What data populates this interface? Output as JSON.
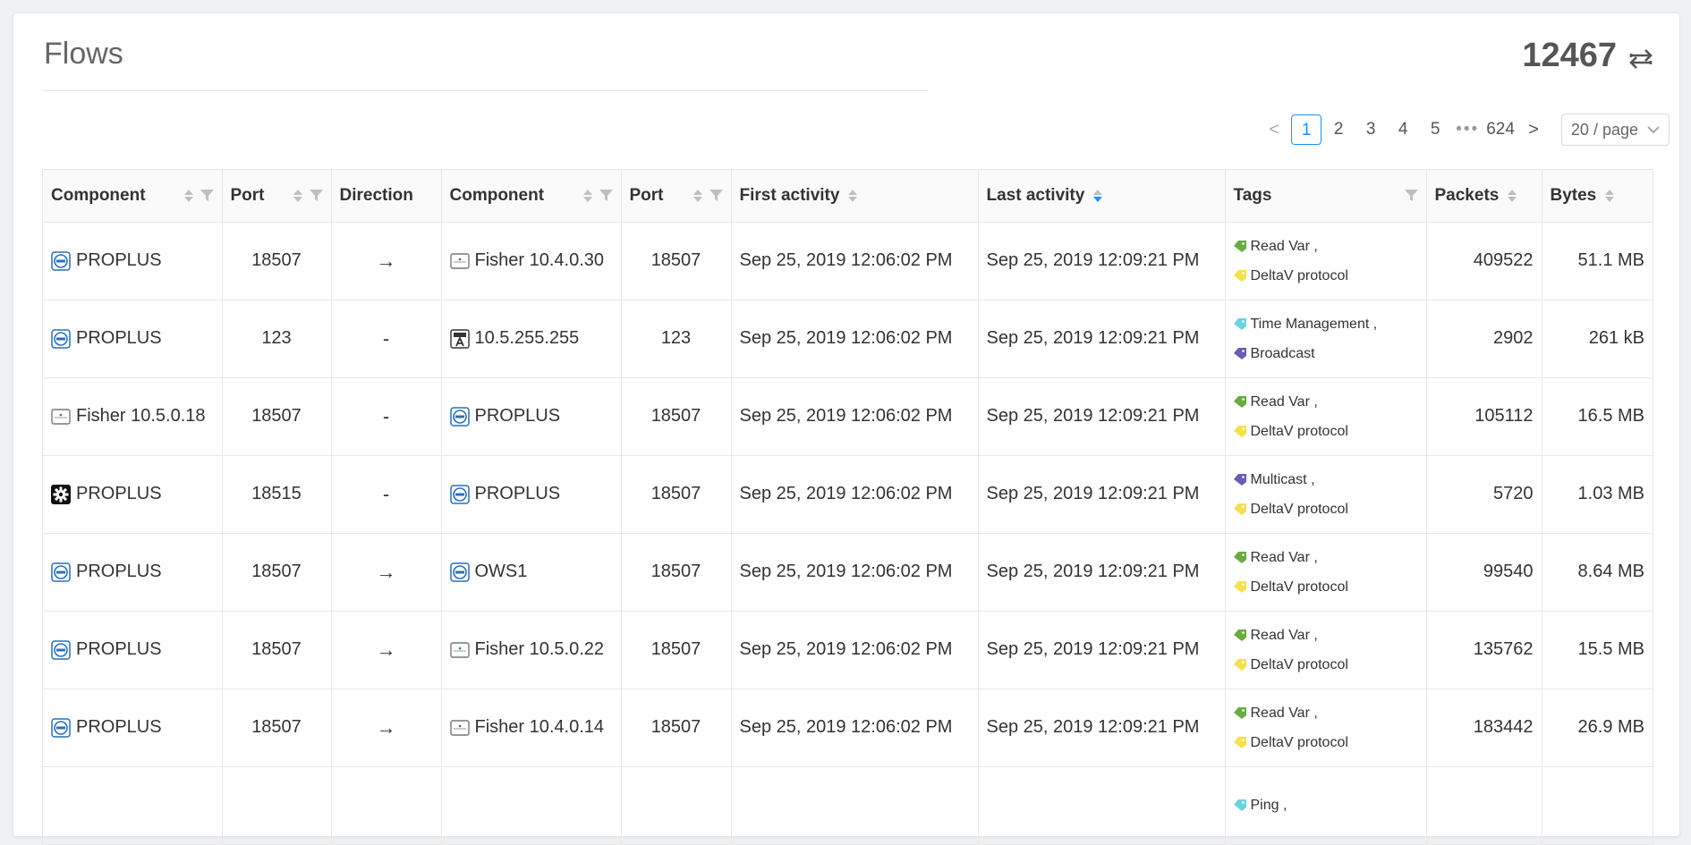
{
  "header": {
    "title": "Flows",
    "total": "12467"
  },
  "pagination": {
    "prev": "<",
    "next": ">",
    "pages": [
      "1",
      "2",
      "3",
      "4",
      "5"
    ],
    "ellipsis": "•••",
    "last": "624",
    "page_size": "20 / page"
  },
  "columns": [
    "Component",
    "Port",
    "Direction",
    "Component",
    "Port",
    "First activity",
    "Last activity",
    "Tags",
    "Packets",
    "Bytes"
  ],
  "colors": {
    "green": "#6aab43",
    "yellow": "#f5e04e",
    "cyan": "#6cd3de",
    "purple": "#6b5bb2",
    "blue": "#1890ff"
  },
  "rows": [
    {
      "src_icon": "dell-icon",
      "src": "PROPLUS",
      "sport": "18507",
      "dir": "→",
      "dst_icon": "device-icon",
      "dst": "Fisher 10.4.0.30",
      "dport": "18507",
      "first": "Sep 25, 2019 12:06:02 PM",
      "last": "Sep 25, 2019 12:09:21 PM",
      "tags": [
        {
          "label": "Read Var ,",
          "color": "green"
        },
        {
          "label": "DeltaV protocol",
          "color": "yellow"
        }
      ],
      "packets": "409522",
      "bytes": "51.1 MB"
    },
    {
      "src_icon": "dell-icon",
      "src": "PROPLUS",
      "sport": "123",
      "dir": "-",
      "dst_icon": "broadcast-icon",
      "dst": "10.5.255.255",
      "dport": "123",
      "first": "Sep 25, 2019 12:06:02 PM",
      "last": "Sep 25, 2019 12:09:21 PM",
      "tags": [
        {
          "label": "Time Management ,",
          "color": "cyan"
        },
        {
          "label": "Broadcast",
          "color": "purple"
        }
      ],
      "packets": "2902",
      "bytes": "261 kB"
    },
    {
      "src_icon": "device-icon",
      "src": "Fisher 10.5.0.18",
      "sport": "18507",
      "dir": "-",
      "dst_icon": "dell-icon",
      "dst": "PROPLUS",
      "dport": "18507",
      "first": "Sep 25, 2019 12:06:02 PM",
      "last": "Sep 25, 2019 12:09:21 PM",
      "tags": [
        {
          "label": "Read Var ,",
          "color": "green"
        },
        {
          "label": "DeltaV protocol",
          "color": "yellow"
        }
      ],
      "packets": "105112",
      "bytes": "16.5 MB"
    },
    {
      "src_icon": "gear-icon",
      "src": "PROPLUS",
      "sport": "18515",
      "dir": "-",
      "dst_icon": "dell-icon",
      "dst": "PROPLUS",
      "dport": "18507",
      "first": "Sep 25, 2019 12:06:02 PM",
      "last": "Sep 25, 2019 12:09:21 PM",
      "tags": [
        {
          "label": "Multicast ,",
          "color": "purple"
        },
        {
          "label": "DeltaV protocol",
          "color": "yellow"
        }
      ],
      "packets": "5720",
      "bytes": "1.03 MB"
    },
    {
      "src_icon": "dell-icon",
      "src": "PROPLUS",
      "sport": "18507",
      "dir": "→",
      "dst_icon": "dell-icon",
      "dst": "OWS1",
      "dport": "18507",
      "first": "Sep 25, 2019 12:06:02 PM",
      "last": "Sep 25, 2019 12:09:21 PM",
      "tags": [
        {
          "label": "Read Var ,",
          "color": "green"
        },
        {
          "label": "DeltaV protocol",
          "color": "yellow"
        }
      ],
      "packets": "99540",
      "bytes": "8.64 MB"
    },
    {
      "src_icon": "dell-icon",
      "src": "PROPLUS",
      "sport": "18507",
      "dir": "→",
      "dst_icon": "device-icon",
      "dst": "Fisher 10.5.0.22",
      "dport": "18507",
      "first": "Sep 25, 2019 12:06:02 PM",
      "last": "Sep 25, 2019 12:09:21 PM",
      "tags": [
        {
          "label": "Read Var ,",
          "color": "green"
        },
        {
          "label": "DeltaV protocol",
          "color": "yellow"
        }
      ],
      "packets": "135762",
      "bytes": "15.5 MB"
    },
    {
      "src_icon": "dell-icon",
      "src": "PROPLUS",
      "sport": "18507",
      "dir": "→",
      "dst_icon": "device-icon",
      "dst": "Fisher 10.4.0.14",
      "dport": "18507",
      "first": "Sep 25, 2019 12:06:02 PM",
      "last": "Sep 25, 2019 12:09:21 PM",
      "tags": [
        {
          "label": "Read Var ,",
          "color": "green"
        },
        {
          "label": "DeltaV protocol",
          "color": "yellow"
        }
      ],
      "packets": "183442",
      "bytes": "26.9 MB"
    },
    {
      "src_icon": "",
      "src": "",
      "sport": "",
      "dir": "",
      "dst_icon": "",
      "dst": "",
      "dport": "",
      "first": "",
      "last": "",
      "tags": [
        {
          "label": "Ping ,",
          "color": "cyan"
        }
      ],
      "packets": "",
      "bytes": ""
    }
  ]
}
